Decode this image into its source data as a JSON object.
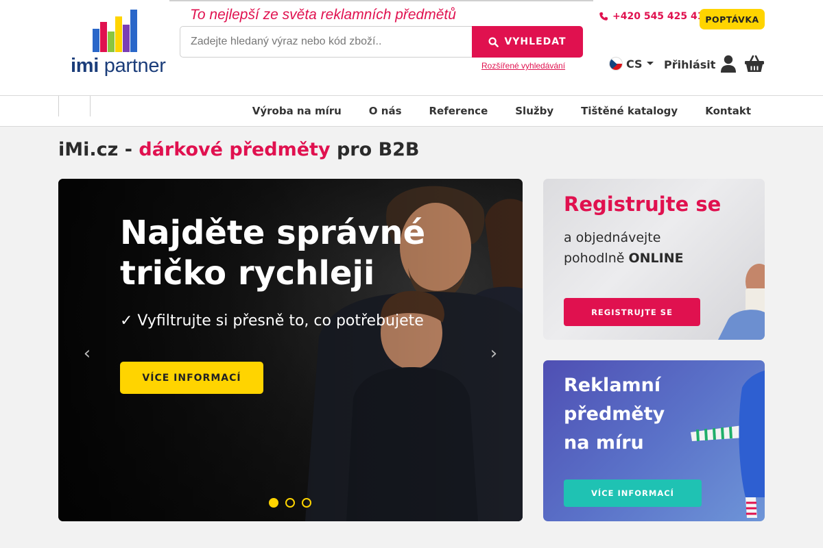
{
  "brand": {
    "logo_word1": "imi",
    "logo_word2": "partner",
    "tagline": "To nejlepší ze světa reklamních předmětů",
    "accent_color": "#e0114f",
    "yellow": "#ffd400"
  },
  "search": {
    "placeholder": "Zadejte hledaný výraz nebo kód zboží..",
    "button_label": "VYHLEDAT",
    "advanced_link": "Rozšířené vyhledávání"
  },
  "topbar": {
    "phone": "+420 545 425 411",
    "inquiry_label": "POPTÁVKA",
    "language": "CS",
    "login_label": "Přihlásit"
  },
  "nav": {
    "items": [
      {
        "label": "Výroba na míru"
      },
      {
        "label": "O nás"
      },
      {
        "label": "Reference"
      },
      {
        "label": "Služby"
      },
      {
        "label": "Tištěné katalogy"
      },
      {
        "label": "Kontakt"
      }
    ]
  },
  "page": {
    "title_pre": "iMi.cz - ",
    "title_accent": "dárkové předměty",
    "title_post": " pro B2B"
  },
  "hero": {
    "title": "Najděte správné tričko rychleji",
    "subtitle": "✓ Vyfiltrujte si přesně to, co potřebujete",
    "button_label": "VÍCE INFORMACÍ",
    "prev_icon": "‹",
    "next_icon": "›",
    "slide_count": 3,
    "active_slide": 1
  },
  "card_register": {
    "title": "Registrujte se",
    "text_line1": "a objednávejte",
    "text_line2_pre": "pohodlně ",
    "text_line2_bold": "ONLINE",
    "button_label": "REGISTRUJTE SE"
  },
  "card_custom": {
    "title": "Reklamní předměty na míru",
    "button_label": "VÍCE INFORMACÍ"
  }
}
